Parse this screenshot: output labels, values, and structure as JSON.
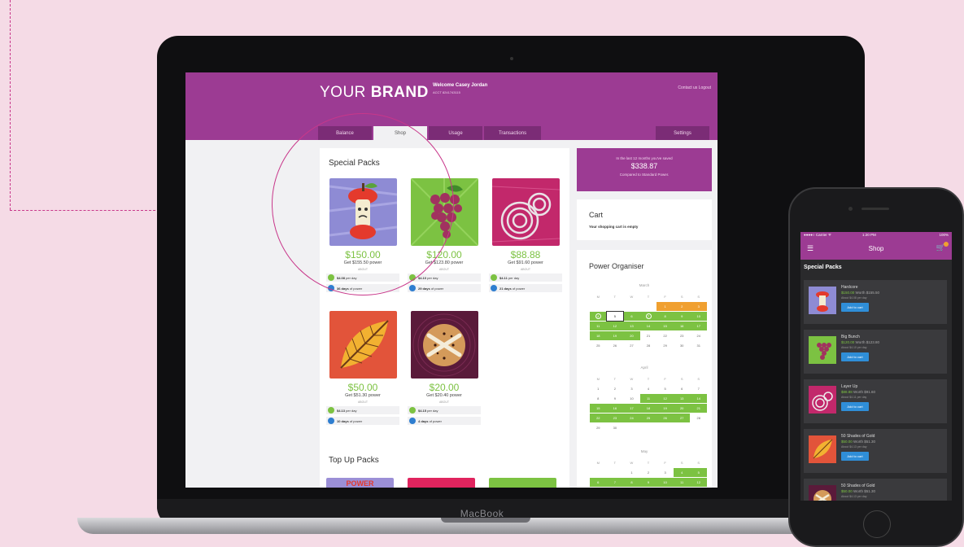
{
  "colors": {
    "brand_purple": "#9c3b93",
    "accent_green": "#7cc242",
    "accent_blue": "#2f7ed0",
    "accent_orange": "#f0a030",
    "highlight_ring": "#c8378a"
  },
  "laptop": {
    "label": "MacBook"
  },
  "header": {
    "brand_light": "YOUR",
    "brand_bold": "BRAND",
    "welcome": "Welcome Casey Jordan",
    "acct": "ACCT 8241743115",
    "links": "Contact us  Logout"
  },
  "tabs": [
    "Balance",
    "Shop",
    "Usage",
    "Transactions"
  ],
  "settings_tab": "Settings",
  "special_packs": {
    "title": "Special Packs",
    "items": [
      {
        "price": "$150.00",
        "get": "Get $155.50 power",
        "about": "ABOUT",
        "per_day": "$4.08",
        "per_day_label": "per day",
        "days": "36 days",
        "days_label": "of power"
      },
      {
        "price": "$120.00",
        "get": "Get $123.80 power",
        "about": "ABOUT",
        "per_day": "$4.10",
        "per_day_label": "per day",
        "days": "29 days",
        "days_label": "of power"
      },
      {
        "price": "$88.88",
        "get": "Get $91.60 power",
        "about": "ABOUT",
        "per_day": "$4.11",
        "per_day_label": "per day",
        "days": "21 days",
        "days_label": "of power"
      },
      {
        "price": "$50.00",
        "get": "Get $51.30 power",
        "about": "ABOUT",
        "per_day": "$4.13",
        "per_day_label": "per day",
        "days": "10 days",
        "days_label": "of power"
      },
      {
        "price": "$20.00",
        "get": "Get $20.40 power",
        "about": "ABOUT",
        "per_day": "$4.15",
        "per_day_label": "per day",
        "days": "4 days",
        "days_label": "of power"
      }
    ]
  },
  "topup_packs": {
    "title": "Top Up Packs",
    "first_label": "POWER"
  },
  "savings": {
    "line1": "In the last 12 months you've saved",
    "amount": "$338.87",
    "line3": "Compared to Standard Power."
  },
  "cart": {
    "title": "Cart",
    "empty": "Your shopping cart is empty"
  },
  "organiser": {
    "title": "Power Organiser",
    "weekdays": [
      "M",
      "T",
      "W",
      "T",
      "F",
      "S",
      "S"
    ],
    "months": [
      {
        "name": "March",
        "weeks": [
          [
            "",
            "",
            "",
            "",
            "1",
            "2",
            "3"
          ],
          [
            "4",
            "5",
            "6",
            "7",
            "8",
            "9",
            "10"
          ],
          [
            "11",
            "12",
            "13",
            "14",
            "15",
            "16",
            "17"
          ],
          [
            "18",
            "19",
            "20",
            "21",
            "22",
            "23",
            "24"
          ],
          [
            "25",
            "26",
            "27",
            "28",
            "29",
            "30",
            "31"
          ]
        ]
      },
      {
        "name": "April",
        "weeks": [
          [
            "1",
            "2",
            "3",
            "4",
            "5",
            "6",
            "7"
          ],
          [
            "8",
            "9",
            "10",
            "11",
            "12",
            "13",
            "14"
          ],
          [
            "15",
            "16",
            "17",
            "18",
            "19",
            "20",
            "21"
          ],
          [
            "22",
            "23",
            "24",
            "25",
            "26",
            "27",
            "28"
          ],
          [
            "29",
            "30",
            "",
            "",
            "",
            "",
            ""
          ]
        ]
      },
      {
        "name": "May",
        "weeks": [
          [
            "",
            "",
            "1",
            "2",
            "3",
            "4",
            "5"
          ],
          [
            "6",
            "7",
            "8",
            "9",
            "10",
            "11",
            "12"
          ]
        ]
      }
    ]
  },
  "phone": {
    "carrier": "●●●●○ Carrier ᯤ",
    "time": "1:20 PM",
    "battery": "100%",
    "nav_title": "Shop",
    "section": "Special Packs",
    "items": [
      {
        "name": "Hardcore",
        "price": "$150.00",
        "worth": "Worth $155.50",
        "about": "About $4.08 per day",
        "button": "Add to cart"
      },
      {
        "name": "Big Bunch",
        "price": "$120.00",
        "worth": "Worth $123.80",
        "about": "About $4.10 per day",
        "button": "Add to cart"
      },
      {
        "name": "Layer Up",
        "price": "$88.88",
        "worth": "Worth $91.60",
        "about": "About $4.11 per day",
        "button": "Add to cart"
      },
      {
        "name": "50 Shades of Gold",
        "price": "$50.00",
        "worth": "Worth $51.30",
        "about": "About $4.13 per day",
        "button": "Add to cart"
      },
      {
        "name": "50 Shades of Gold",
        "price": "$50.00",
        "worth": "Worth $51.30",
        "about": "About $4.13 per day",
        "button": "Add to cart"
      }
    ]
  }
}
